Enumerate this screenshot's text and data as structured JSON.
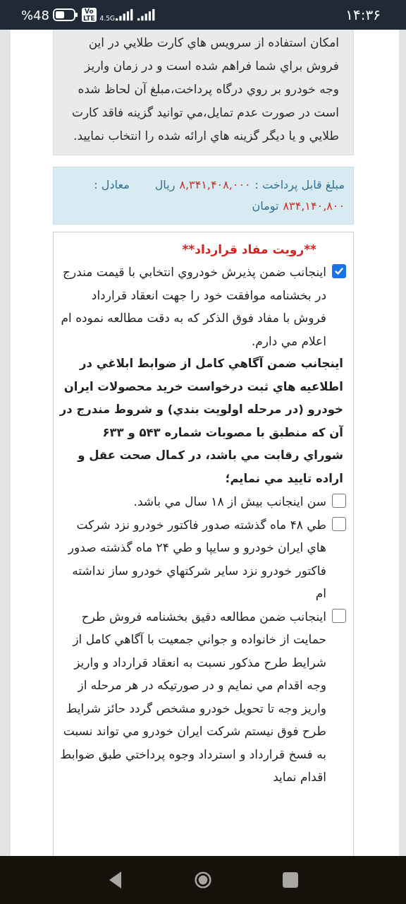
{
  "status_bar": {
    "time": "۱۴:۳۶",
    "battery": "%48",
    "volte": [
      "Vo",
      "LTE"
    ],
    "network": "4.5G"
  },
  "notice": {
    "text": "امكان استفاده از سرويس هاي كارت طلايي در اين فروش براي شما فراهم شده است و در زمان واريز وجه خودرو بر روي درگاه پرداخت،مبلغ آن لحاظ شده است در صورت عدم تمايل،مي توانيد گزينه فاقد كارت طلايي و يا ديگر گزينه هاي ارائه شده را انتخاب نماييد."
  },
  "payment": {
    "label": "مبلغ قابل پرداخت :",
    "amount_rial": "۸,۳۴۱,۴۰۸,۰۰۰",
    "unit_rial": "ريال",
    "equivalent_label": "معادل :",
    "amount_toman": "۸۳۴,۱۴۰,۸۰۰",
    "unit_toman": "تومان"
  },
  "contract": {
    "title": "**رويت مفاد قرارداد**",
    "items": [
      {
        "kind": "checkbox",
        "checked": true,
        "text": "اينجانب ضمن پذيرش خودروي انتخابي با قيمت مندرج در بخشنامه موافقت خود را جهت انعقاد قرارداد فروش با مفاد فوق الذكر كه به دقت مطالعه نموده ام اعلام مي دارم."
      },
      {
        "kind": "statement",
        "text": "اينجانب ضمن آگاهي كامل از ضوابط ابلاغي در اطلاعيه هاي ثبت درخواست خريد محصولات ايران خودرو (در مرحله اولويت بندي) و شروط مندرج در آن كه منطبق با مصوبات شماره ۵۴۳ و ۶۳۳ شوراي رقابت مي باشد، در كمال صحت عقل و اراده تاييد مي نمايم؛"
      },
      {
        "kind": "checkbox",
        "checked": false,
        "text": "سن اينجانب بيش از ۱۸ سال مي باشد."
      },
      {
        "kind": "checkbox",
        "checked": false,
        "text": "طي ۴۸ ماه گذشته صدور فاكتور خودرو نزد شركت هاي ايران خودرو و سايپا و طي ۲۴ ماه گذشته صدور فاكتور خودرو نزد ساير شركتهاي خودرو ساز نداشته ام"
      },
      {
        "kind": "checkbox",
        "checked": false,
        "text": "اينجانب ضمن مطالعه دقيق بخشنامه فروش طرح حمايت از خانواده و جواني جمعيت با آگاهي كامل از شرايط طرح مذكور نسبت به انعقاد قرارداد و واريز وجه اقدام مي نمايم و در صورتيكه در هر مرحله از واريز وجه تا تحويل خودرو مشخص گردد حائز شرايط طرح فوق نيستم شركت ايران خودرو مي تواند نسبت به فسخ قرارداد و استرداد وجوه پرداختي طبق ضوابط اقدام نمايد"
      }
    ]
  }
}
